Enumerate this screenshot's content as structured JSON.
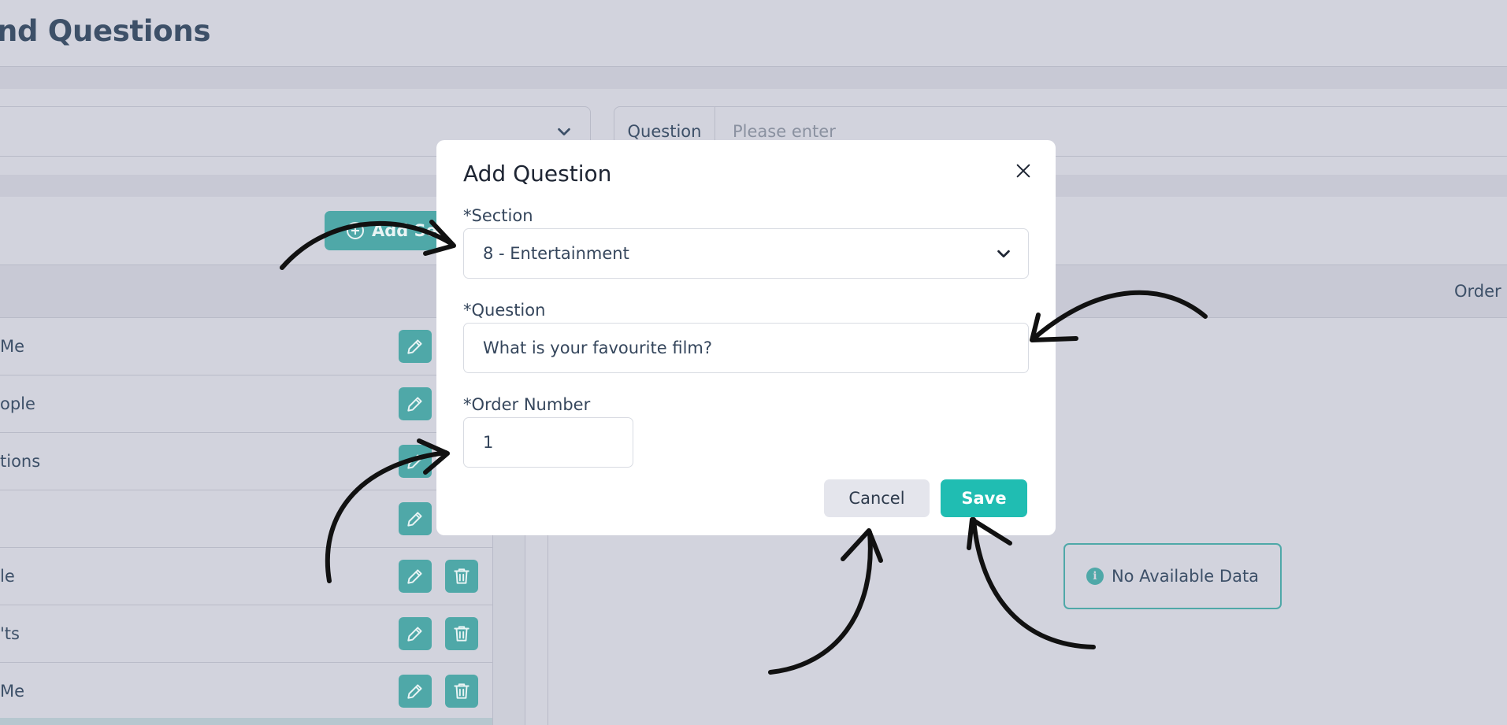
{
  "page": {
    "title": "nd Questions"
  },
  "filters": {
    "section_select_value": "",
    "question_label": "Question",
    "question_placeholder": "Please enter"
  },
  "sections_panel": {
    "add_button_label": "Add Se",
    "rows": [
      {
        "label": "Me",
        "has_delete": false
      },
      {
        "label": "ople",
        "has_delete": false
      },
      {
        "label": "tions",
        "has_delete": false
      },
      {
        "label": "",
        "has_delete": false
      },
      {
        "label": "le",
        "has_delete": true
      },
      {
        "label": "'ts",
        "has_delete": true
      },
      {
        "label": "Me",
        "has_delete": true
      }
    ]
  },
  "questions_panel": {
    "order_header": "Order",
    "empty_text": "No Available Data"
  },
  "modal": {
    "title": "Add Question",
    "section_label": "*Section",
    "section_value": "8 - Entertainment",
    "question_label": "*Question",
    "question_value": "What is your favourite film?",
    "order_label": "*Order Number",
    "order_value": "1",
    "cancel_label": "Cancel",
    "save_label": "Save"
  },
  "colors": {
    "accent": "#20bdb2",
    "teal_muted": "#4fa8a8",
    "overlay_bg": "#d2d3dd",
    "text_dark": "#35465c"
  },
  "icons": [
    "chevron-down-icon",
    "plus-circle-icon",
    "pencil-icon",
    "trash-icon",
    "info-icon",
    "close-icon"
  ]
}
